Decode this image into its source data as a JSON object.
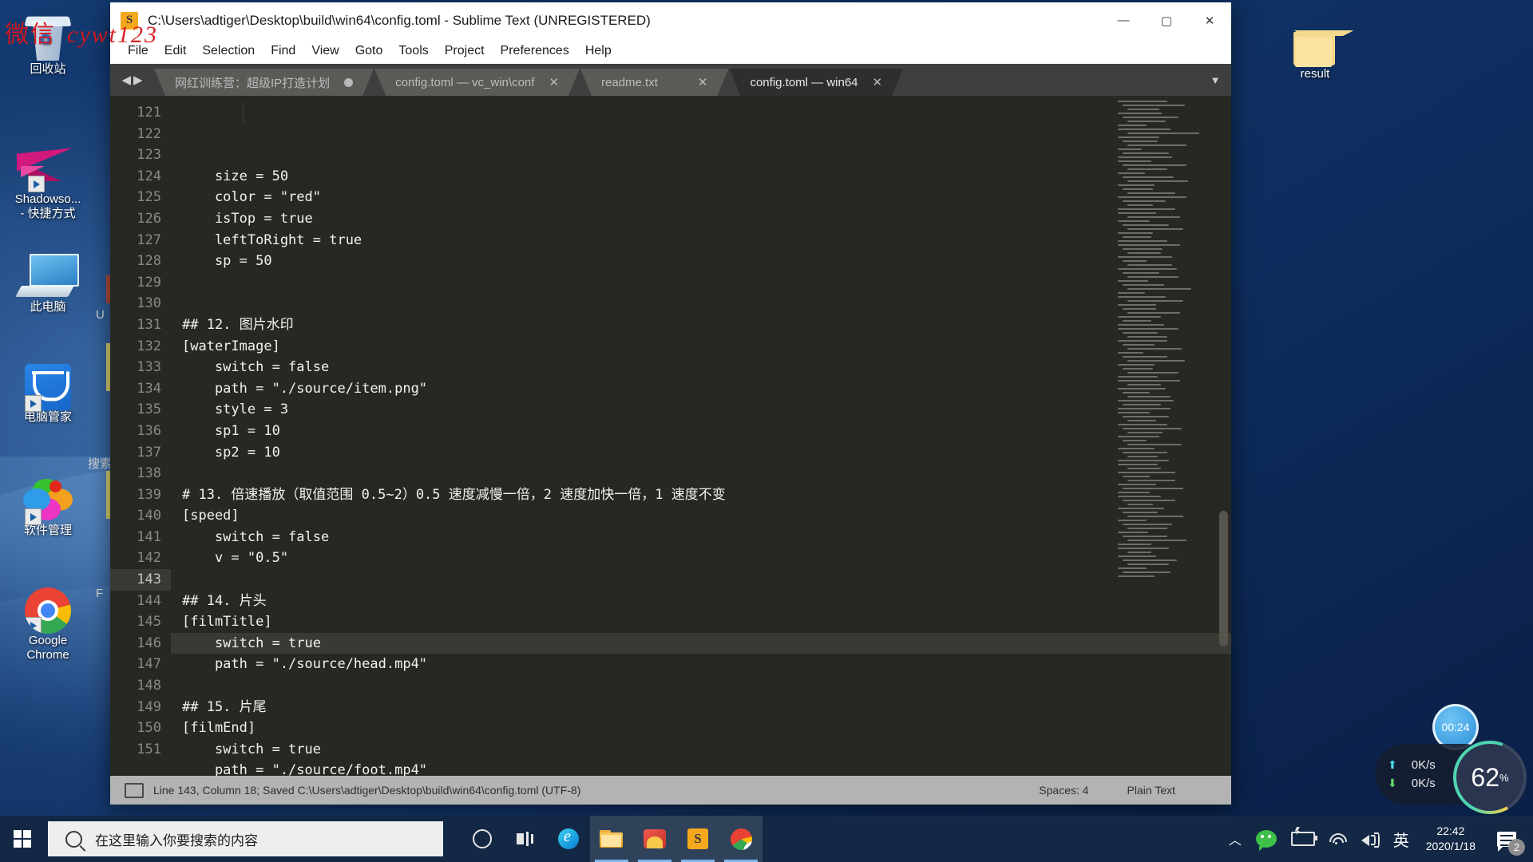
{
  "watermark": {
    "cn": "微信",
    "en": "cywt123"
  },
  "desktop": {
    "icons": [
      {
        "name": "recycle-bin",
        "label": "回收站"
      },
      {
        "name": "shadowsocks",
        "label": "Shadowso...\n- 快捷方式"
      },
      {
        "name": "this-pc",
        "label": "此电脑"
      },
      {
        "name": "pc-manager",
        "label": "电脑管家"
      },
      {
        "name": "software-manager",
        "label": "软件管理"
      },
      {
        "name": "google-chrome",
        "label": "Google\nChrome"
      }
    ],
    "result_folder": {
      "label": "result"
    }
  },
  "sublime": {
    "title": "C:\\Users\\adtiger\\Desktop\\build\\win64\\config.toml - Sublime Text (UNREGISTERED)",
    "logo_letter": "S",
    "window_controls": {
      "minimize": "—",
      "maximize": "▢",
      "close": "✕"
    },
    "menu": [
      "File",
      "Edit",
      "Selection",
      "Find",
      "View",
      "Goto",
      "Tools",
      "Project",
      "Preferences",
      "Help"
    ],
    "tabs": [
      {
        "label": "网红训练营：超级IP打造计划",
        "modified": true,
        "active": false
      },
      {
        "label": "config.toml — vc_win\\conf",
        "modified": false,
        "active": false
      },
      {
        "label": "readme.txt",
        "modified": false,
        "active": false
      },
      {
        "label": "config.toml — win64",
        "modified": false,
        "active": true
      }
    ],
    "tab_close_glyph": "✕",
    "tab_nav_left": "◀",
    "tab_nav_right": "▶",
    "tab_menu_glyph": "▼",
    "code": {
      "first_line_number": 121,
      "current_line": 143,
      "lines": [
        "    size = 50",
        "    color = \"red\"",
        "    isTop = true",
        "    leftToRight = true",
        "    sp = 50",
        "",
        "",
        "## 12. 图片水印",
        "[waterImage]",
        "    switch = false",
        "    path = \"./source/item.png\"",
        "    style = 3",
        "    sp1 = 10",
        "    sp2 = 10",
        "",
        "# 13. 倍速播放（取值范围 0.5~2）0.5 速度减慢一倍，2 速度加快一倍，1 速度不变",
        "[speed]",
        "    switch = false",
        "    v = \"0.5\"",
        "",
        "## 14. 片头",
        "[filmTitle]",
        "    switch = true",
        "    path = \"./source/head.mp4\"",
        "",
        "## 15. 片尾",
        "[filmEnd]",
        "    switch = true",
        "    path = \"./source/foot.mp4\"",
        "",
        ""
      ]
    },
    "statusbar": {
      "message": "Line 143, Column 18; Saved C:\\Users\\adtiger\\Desktop\\build\\win64\\config.toml (UTF-8)",
      "indent": "Spaces: 4",
      "syntax": "Plain Text"
    }
  },
  "background_window_text": [
    "U",
    "搜索",
    "F"
  ],
  "perf_widget": {
    "timer": "00:24",
    "upload": "0K/s",
    "download": "0K/s",
    "upload_arrow": "⬆",
    "download_arrow": "⬇",
    "cpu_value": "62",
    "cpu_unit": "%"
  },
  "taskbar": {
    "search_placeholder": "在这里输入你要搜索的内容",
    "apps": [
      {
        "name": "cortana",
        "active": false
      },
      {
        "name": "task-view",
        "active": false
      },
      {
        "name": "edge",
        "active": false
      },
      {
        "name": "file-explorer",
        "active": true
      },
      {
        "name": "photo-app",
        "active": true
      },
      {
        "name": "sublime-text",
        "active": true
      },
      {
        "name": "google-chrome",
        "active": true
      }
    ],
    "tray": {
      "chevron": "︿",
      "ime": "英",
      "time": "22:42",
      "date": "2020/1/18",
      "notification_count": "2"
    }
  }
}
